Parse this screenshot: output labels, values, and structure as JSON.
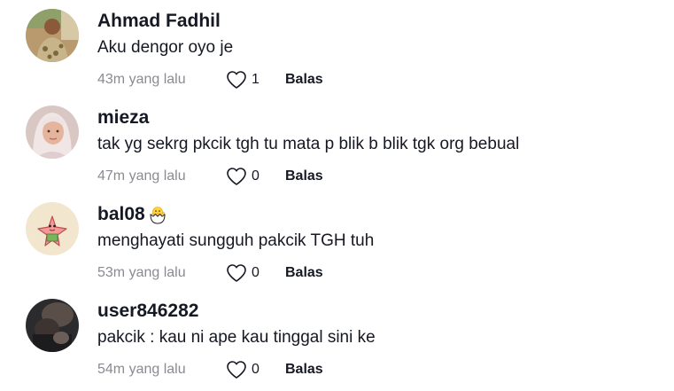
{
  "comments": [
    {
      "username": "Ahmad Fadhil",
      "text": "Aku dengor oyo je",
      "time": "43m yang lalu",
      "likes": "1",
      "reply": "Balas",
      "avatar": "photo-man-outdoor"
    },
    {
      "username": "mieza",
      "text": "tak yg sekrg pkcik tgh tu mata p blik b blik tgk org bebual",
      "time": "47m yang lalu",
      "likes": "0",
      "reply": "Balas",
      "avatar": "photo-woman-hijab"
    },
    {
      "username": "bal08",
      "username_emoji": "hatching-chick-emoji",
      "text": "menghayati sungguh pakcik TGH tuh",
      "time": "53m yang lalu",
      "likes": "0",
      "reply": "Balas",
      "avatar": "cartoon-starfish"
    },
    {
      "username": "user846282",
      "text": "pakcik : kau ni ape kau tinggal sini ke",
      "time": "54m yang lalu",
      "likes": "0",
      "reply": "Balas",
      "avatar": "photo-dark"
    }
  ],
  "colors": {
    "text": "#161823",
    "muted": "#8a8b91"
  }
}
